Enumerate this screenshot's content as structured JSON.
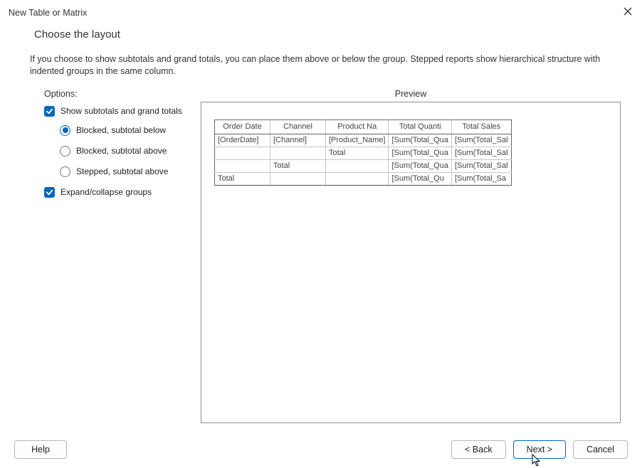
{
  "window": {
    "title": "New Table or Matrix"
  },
  "page": {
    "heading": "Choose the layout",
    "description": "If you choose to show subtotals and grand totals, you can place them above or below the group. Stepped reports show hierarchical structure with indented groups in the same column."
  },
  "options": {
    "title": "Options:",
    "show_subtotals_label": "Show subtotals and grand totals",
    "show_subtotals_checked": true,
    "radios": [
      {
        "label": "Blocked, subtotal below",
        "selected": true
      },
      {
        "label": "Blocked, subtotal above",
        "selected": false
      },
      {
        "label": "Stepped, subtotal above",
        "selected": false
      }
    ],
    "expand_collapse_label": "Expand/collapse groups",
    "expand_collapse_checked": true
  },
  "preview": {
    "title": "Preview",
    "headers": [
      "Order Date",
      "Channel",
      "Product Na",
      "Total Quanti",
      "Total Sales"
    ],
    "rows": [
      [
        "[OrderDate]",
        "[Channel]",
        "[Product_Name]",
        "[Sum(Total_Qua",
        "[Sum(Total_Sal"
      ],
      [
        "",
        "",
        "Total",
        "[Sum(Total_Qua",
        "[Sum(Total_Sal"
      ],
      [
        "",
        "Total",
        "",
        "[Sum(Total_Qua",
        "[Sum(Total_Sal"
      ],
      [
        "Total",
        "",
        "",
        "[Sum(Total_Qu",
        "[Sum(Total_Sa"
      ]
    ]
  },
  "buttons": {
    "help": "Help",
    "back": "< Back",
    "next": "Next >",
    "cancel": "Cancel"
  }
}
